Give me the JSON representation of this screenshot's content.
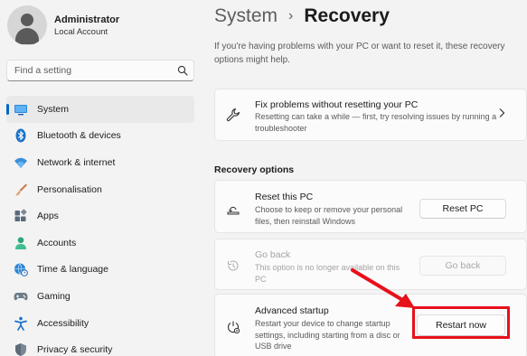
{
  "profile": {
    "name": "Administrator",
    "account_type": "Local Account"
  },
  "search": {
    "placeholder": "Find a setting",
    "icon": "search-icon"
  },
  "sidebar": {
    "items": [
      {
        "label": "System",
        "icon": "monitor-icon",
        "active": true
      },
      {
        "label": "Bluetooth & devices",
        "icon": "bluetooth-icon"
      },
      {
        "label": "Network & internet",
        "icon": "wifi-icon"
      },
      {
        "label": "Personalisation",
        "icon": "brush-icon"
      },
      {
        "label": "Apps",
        "icon": "apps-icon"
      },
      {
        "label": "Accounts",
        "icon": "person-icon"
      },
      {
        "label": "Time & language",
        "icon": "globe-clock-icon"
      },
      {
        "label": "Gaming",
        "icon": "gamepad-icon"
      },
      {
        "label": "Accessibility",
        "icon": "accessibility-icon"
      },
      {
        "label": "Privacy & security",
        "icon": "shield-icon"
      }
    ]
  },
  "header": {
    "parent": "System",
    "separator": "›",
    "current": "Recovery"
  },
  "intro_text": "If you're having problems with your PC or want to reset it, these recovery options might help.",
  "fix_card": {
    "title": "Fix problems without resetting your PC",
    "description": "Resetting can take a while — first, try resolving issues by running a troubleshooter",
    "icon": "wrench-icon"
  },
  "recovery_section_title": "Recovery options",
  "options": [
    {
      "title": "Reset this PC",
      "description": "Choose to keep or remove your personal files, then reinstall Windows",
      "button": "Reset PC",
      "icon": "reset-pc-icon",
      "enabled": true
    },
    {
      "title": "Go back",
      "description": "This option is no longer available on this PC",
      "button": "Go back",
      "icon": "history-icon",
      "enabled": false
    },
    {
      "title": "Advanced startup",
      "description": "Restart your device to change startup settings, including starting from a disc or USB drive",
      "button": "Restart now",
      "icon": "advanced-startup-icon",
      "enabled": true
    }
  ],
  "colors": {
    "accent": "#0067c0",
    "annotation": "#e8101a",
    "background": "#f3f3f3",
    "card": "#fbfbfb"
  }
}
